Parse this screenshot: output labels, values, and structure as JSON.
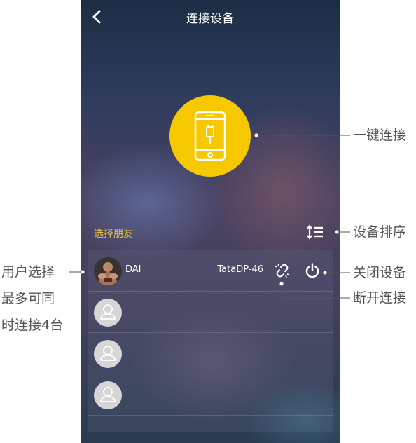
{
  "header": {
    "title": "连接设备",
    "back_icon": "chevron-left-icon"
  },
  "connect_button": {
    "icon": "phone-icon",
    "color": "#f5c800"
  },
  "friends": {
    "label": "选择朋友",
    "sort_icon": "sort-icon",
    "rows": [
      {
        "name": "DAI",
        "device": "TataDP-46",
        "avatar": "photo"
      },
      {
        "name": "",
        "device": "",
        "avatar": "placeholder-icon"
      },
      {
        "name": "",
        "device": "",
        "avatar": "placeholder-icon"
      },
      {
        "name": "",
        "device": "",
        "avatar": "placeholder-icon"
      }
    ]
  },
  "annotations": {
    "one_key_connect": "一键连接",
    "device_sort": "设备排序",
    "close_device": "关闭设备",
    "disconnect": "断开连接",
    "user_select_1": "用户选择",
    "user_select_2": "最多可同",
    "user_select_3": "时连接4台"
  },
  "colors": {
    "accent": "#f5c800",
    "label_yellow": "#e8c13a"
  }
}
